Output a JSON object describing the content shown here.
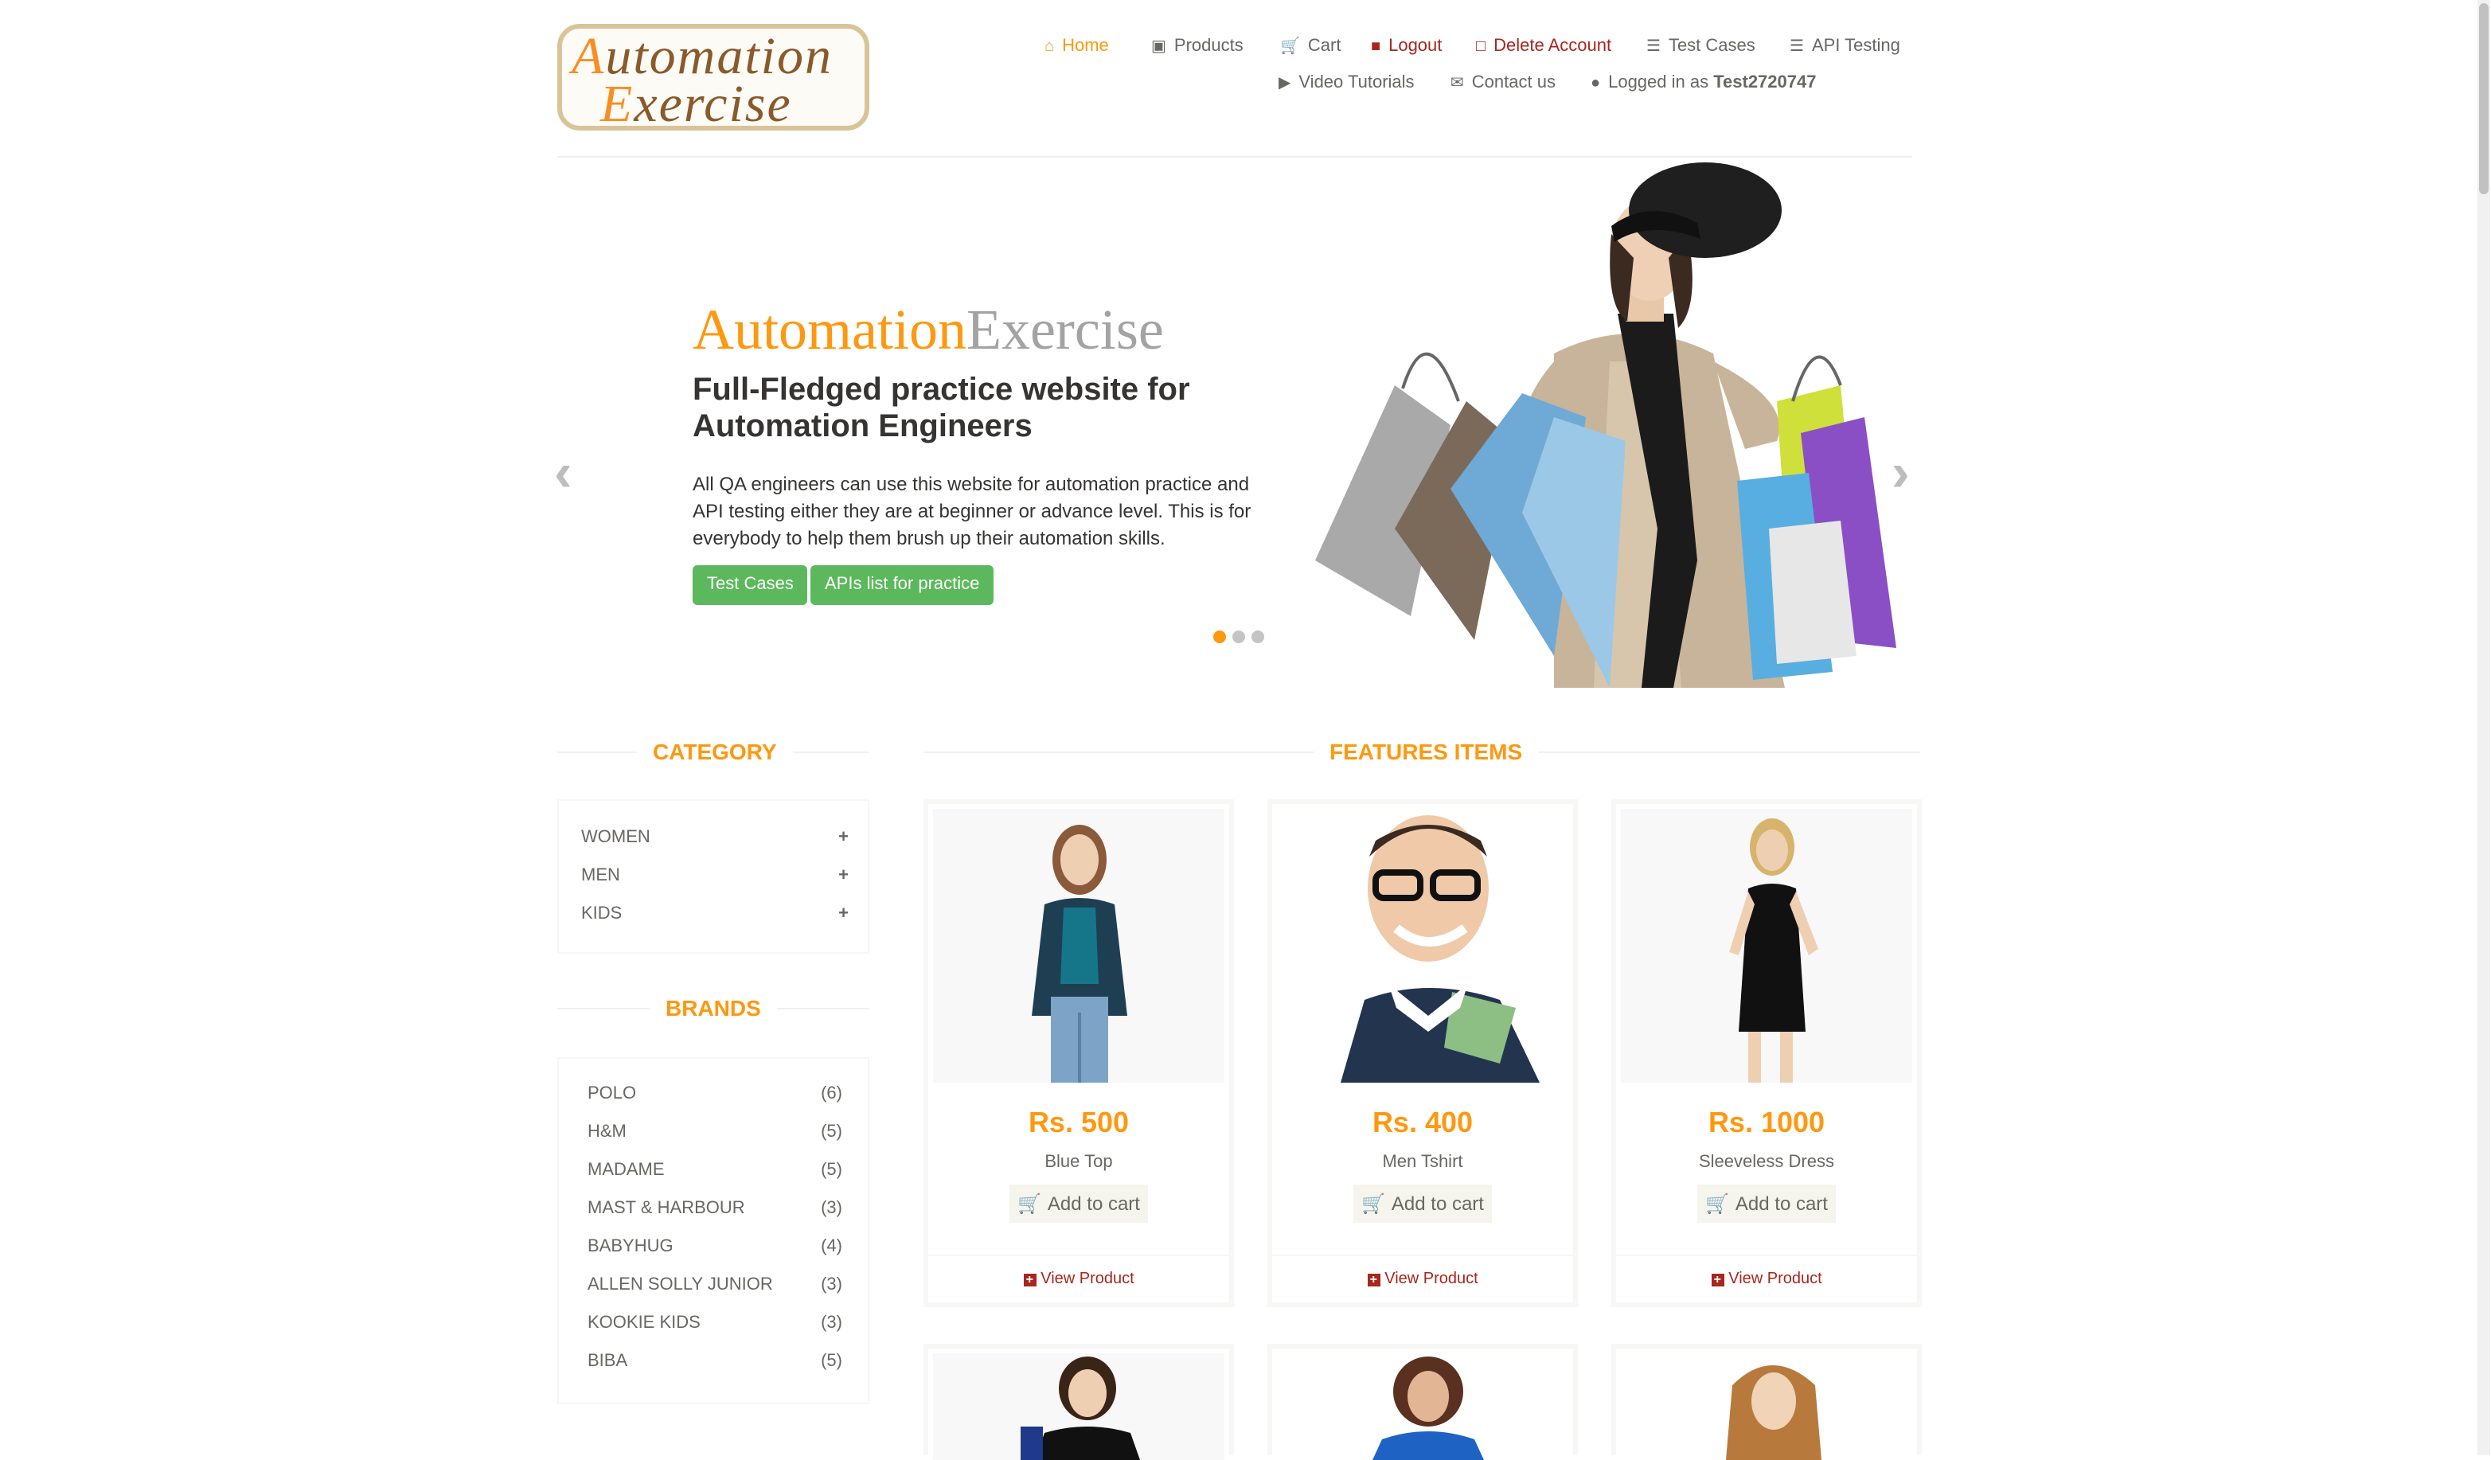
{
  "logo": {
    "line1": "Automation",
    "line2": "Exercise"
  },
  "nav": {
    "home": "Home",
    "products": "Products",
    "cart": "Cart",
    "logout": "Logout",
    "delete_account": "Delete Account",
    "test_cases": "Test Cases",
    "api_testing": "API Testing",
    "video_tutorials": "Video Tutorials",
    "contact_us": "Contact us",
    "logged_in_prefix": "Logged in as",
    "username": "Test2720747"
  },
  "colors": {
    "accent": "#fe980f",
    "danger": "#a9261d",
    "button_green": "#5cb85c",
    "text": "#696763"
  },
  "slider": {
    "brand_part1": "Automation",
    "brand_part2": "Exercise",
    "heading": "Full-Fledged practice website for Automation Engineers",
    "text": "All QA engineers can use this website for automation practice and API testing either they are at beginner or advance level. This is for everybody to help them brush up their automation skills.",
    "button_test_cases": "Test Cases",
    "button_apis": "APIs list for practice",
    "active_slide": 1,
    "slide_count": 3
  },
  "sidebar": {
    "category_title": "CATEGORY",
    "categories": [
      {
        "label": "WOMEN",
        "toggle": "+"
      },
      {
        "label": "MEN",
        "toggle": "+"
      },
      {
        "label": "KIDS",
        "toggle": "+"
      }
    ],
    "brands_title": "BRANDS",
    "brands": [
      {
        "name": "POLO",
        "count": "(6)"
      },
      {
        "name": "H&M",
        "count": "(5)"
      },
      {
        "name": "MADAME",
        "count": "(5)"
      },
      {
        "name": "MAST & HARBOUR",
        "count": "(3)"
      },
      {
        "name": "BABYHUG",
        "count": "(4)"
      },
      {
        "name": "ALLEN SOLLY JUNIOR",
        "count": "(3)"
      },
      {
        "name": "KOOKIE KIDS",
        "count": "(3)"
      },
      {
        "name": "BIBA",
        "count": "(5)"
      }
    ]
  },
  "features": {
    "title": "FEATURES ITEMS",
    "add_to_cart": "Add to cart",
    "view_product": "View Product",
    "products": [
      {
        "price": "Rs. 500",
        "name": "Blue Top"
      },
      {
        "price": "Rs. 400",
        "name": "Men Tshirt"
      },
      {
        "price": "Rs. 1000",
        "name": "Sleeveless Dress"
      }
    ]
  }
}
